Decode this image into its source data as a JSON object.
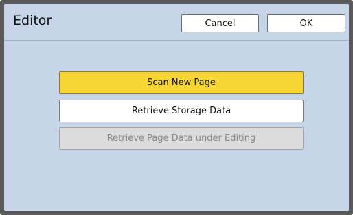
{
  "dialog": {
    "title": "Editor",
    "cancel_label": "Cancel",
    "ok_label": "OK"
  },
  "actions": {
    "scan_label": "Scan New Page",
    "retrieve_storage_label": "Retrieve Storage Data",
    "retrieve_page_label": "Retrieve Page Data under Editing"
  },
  "colors": {
    "background": "#c6d6e8",
    "primary_button": "#f6d534",
    "disabled_button": "#dcdcdc",
    "frame": "#5a5a5a"
  }
}
